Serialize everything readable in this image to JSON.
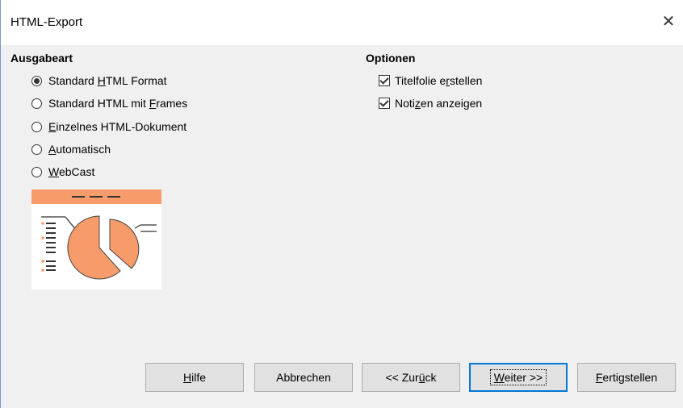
{
  "window": {
    "title": "HTML-Export",
    "close_glyph": "✕"
  },
  "output_type": {
    "title": "Ausgabeart",
    "options": [
      {
        "pre": "Standard ",
        "key": "H",
        "post": "TML Format",
        "selected": true
      },
      {
        "pre": "Standard HTML mit ",
        "key": "F",
        "post": "rames",
        "selected": false
      },
      {
        "pre": "",
        "key": "E",
        "post": "inzelnes HTML-Dokument",
        "selected": false
      },
      {
        "pre": "",
        "key": "A",
        "post": "utomatisch",
        "selected": false
      },
      {
        "pre": "",
        "key": "W",
        "post": "ebCast",
        "selected": false
      }
    ]
  },
  "options": {
    "title": "Optionen",
    "items": [
      {
        "pre": "Titelfolie e",
        "key": "r",
        "post": "stellen",
        "checked": true
      },
      {
        "pre": "Noti",
        "key": "z",
        "post": "en anzeigen",
        "checked": true
      }
    ]
  },
  "preview": {
    "icon": "pie-chart-preview-icon",
    "accent_color": "#f79b6b"
  },
  "buttons": {
    "help": {
      "pre": "",
      "key": "H",
      "post": "ilfe"
    },
    "cancel": {
      "label": "Abbrechen"
    },
    "back": {
      "pre": "<< Zur",
      "key": "ü",
      "post": "ck"
    },
    "next": {
      "pre": "",
      "key": "W",
      "post": "eiter >>"
    },
    "finish": {
      "pre": "",
      "key": "F",
      "post": "ertigstellen"
    }
  }
}
